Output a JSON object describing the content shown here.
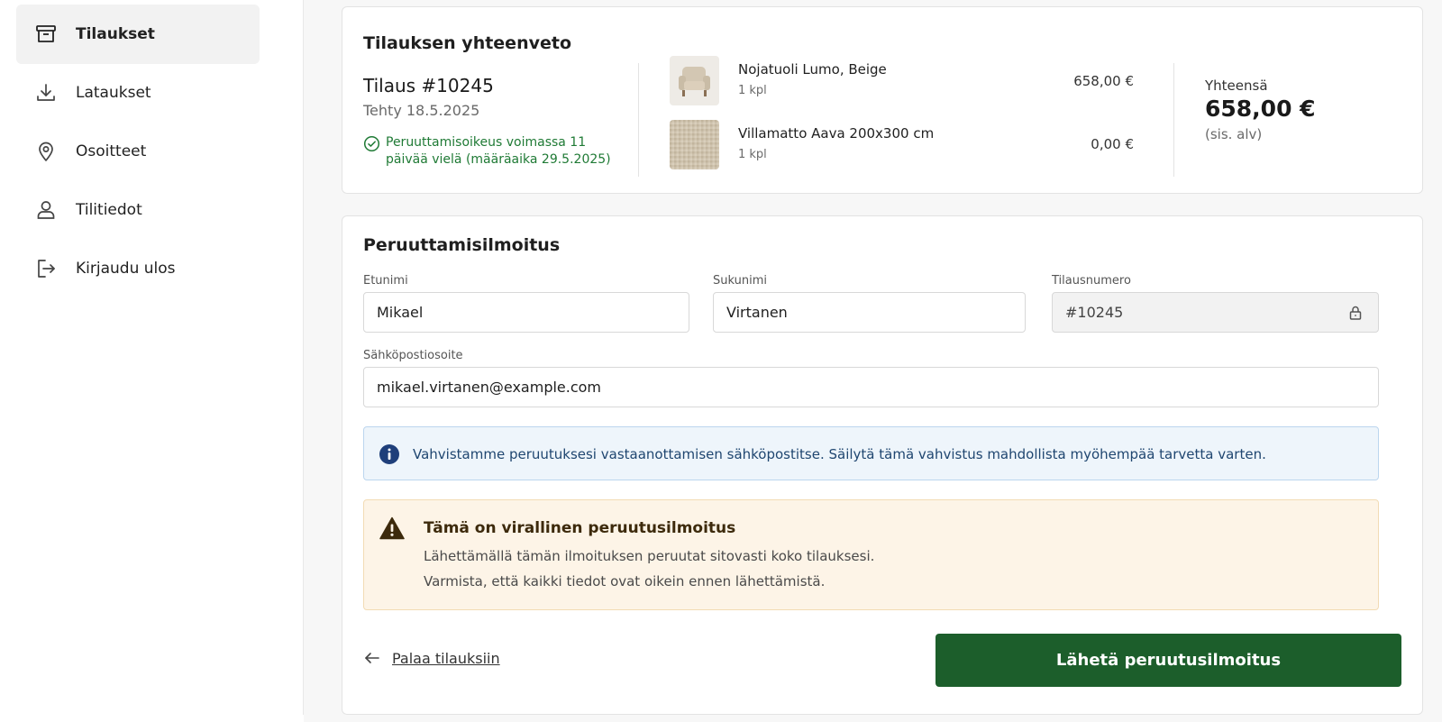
{
  "sidebar": {
    "items": [
      {
        "label": "Tilaukset",
        "icon": "archive-box-icon",
        "active": true
      },
      {
        "label": "Lataukset",
        "icon": "download-icon",
        "active": false
      },
      {
        "label": "Osoitteet",
        "icon": "map-pin-icon",
        "active": false
      },
      {
        "label": "Tilitiedot",
        "icon": "user-icon",
        "active": false
      },
      {
        "label": "Kirjaudu ulos",
        "icon": "logout-icon",
        "active": false
      }
    ]
  },
  "summary": {
    "title": "Tilauksen yhteenveto",
    "order_number": "Tilaus #10245",
    "order_date": "Tehty 18.5.2025",
    "withdrawal_status": "Peruuttamisoikeus voimassa 11 päivää vielä (määräaika 29.5.2025)",
    "products": [
      {
        "name": "Nojatuoli Lumo, Beige",
        "qty": "1 kpl",
        "price": "658,00 €",
        "thumb": "armchair-thumbnail"
      },
      {
        "name": "Villamatto Aava 200x300 cm",
        "qty": "1 kpl",
        "price": "0,00 €",
        "thumb": "rug-thumbnail"
      }
    ],
    "total_label": "Yhteensä",
    "total_amount": "658,00 €",
    "total_vat": "(sis. alv)"
  },
  "form": {
    "title": "Peruuttamisilmoitus",
    "first_name": {
      "label": "Etunimi",
      "value": "Mikael"
    },
    "last_name": {
      "label": "Sukunimi",
      "value": "Virtanen"
    },
    "order_number": {
      "label": "Tilausnumero",
      "value": "#10245"
    },
    "email": {
      "label": "Sähköpostiosoite",
      "value": "mikael.virtanen@example.com"
    },
    "info_text": "Vahvistamme peruutuksesi vastaanottamisen sähköpostitse. Säilytä tämä vahvistus mahdollista myöhempää tarvetta varten.",
    "warning_title": "Tämä on virallinen peruutusilmoitus",
    "warning_line1": "Lähettämällä tämän ilmoituksen peruutat sitovasti koko tilauksesi.",
    "warning_line2": "Varmista, että kaikki tiedot ovat oikein ennen lähettämistä.",
    "back_label": "Palaa tilauksiin",
    "submit_label": "Lähetä peruutusilmoitus"
  },
  "colors": {
    "primary": "#1c5e2b",
    "success": "#1f7a35",
    "info_bg": "#eef5fb",
    "info_icon": "#1f3f7a",
    "warning_bg": "#fdf4e7",
    "warning_icon": "#3d2a0c"
  }
}
